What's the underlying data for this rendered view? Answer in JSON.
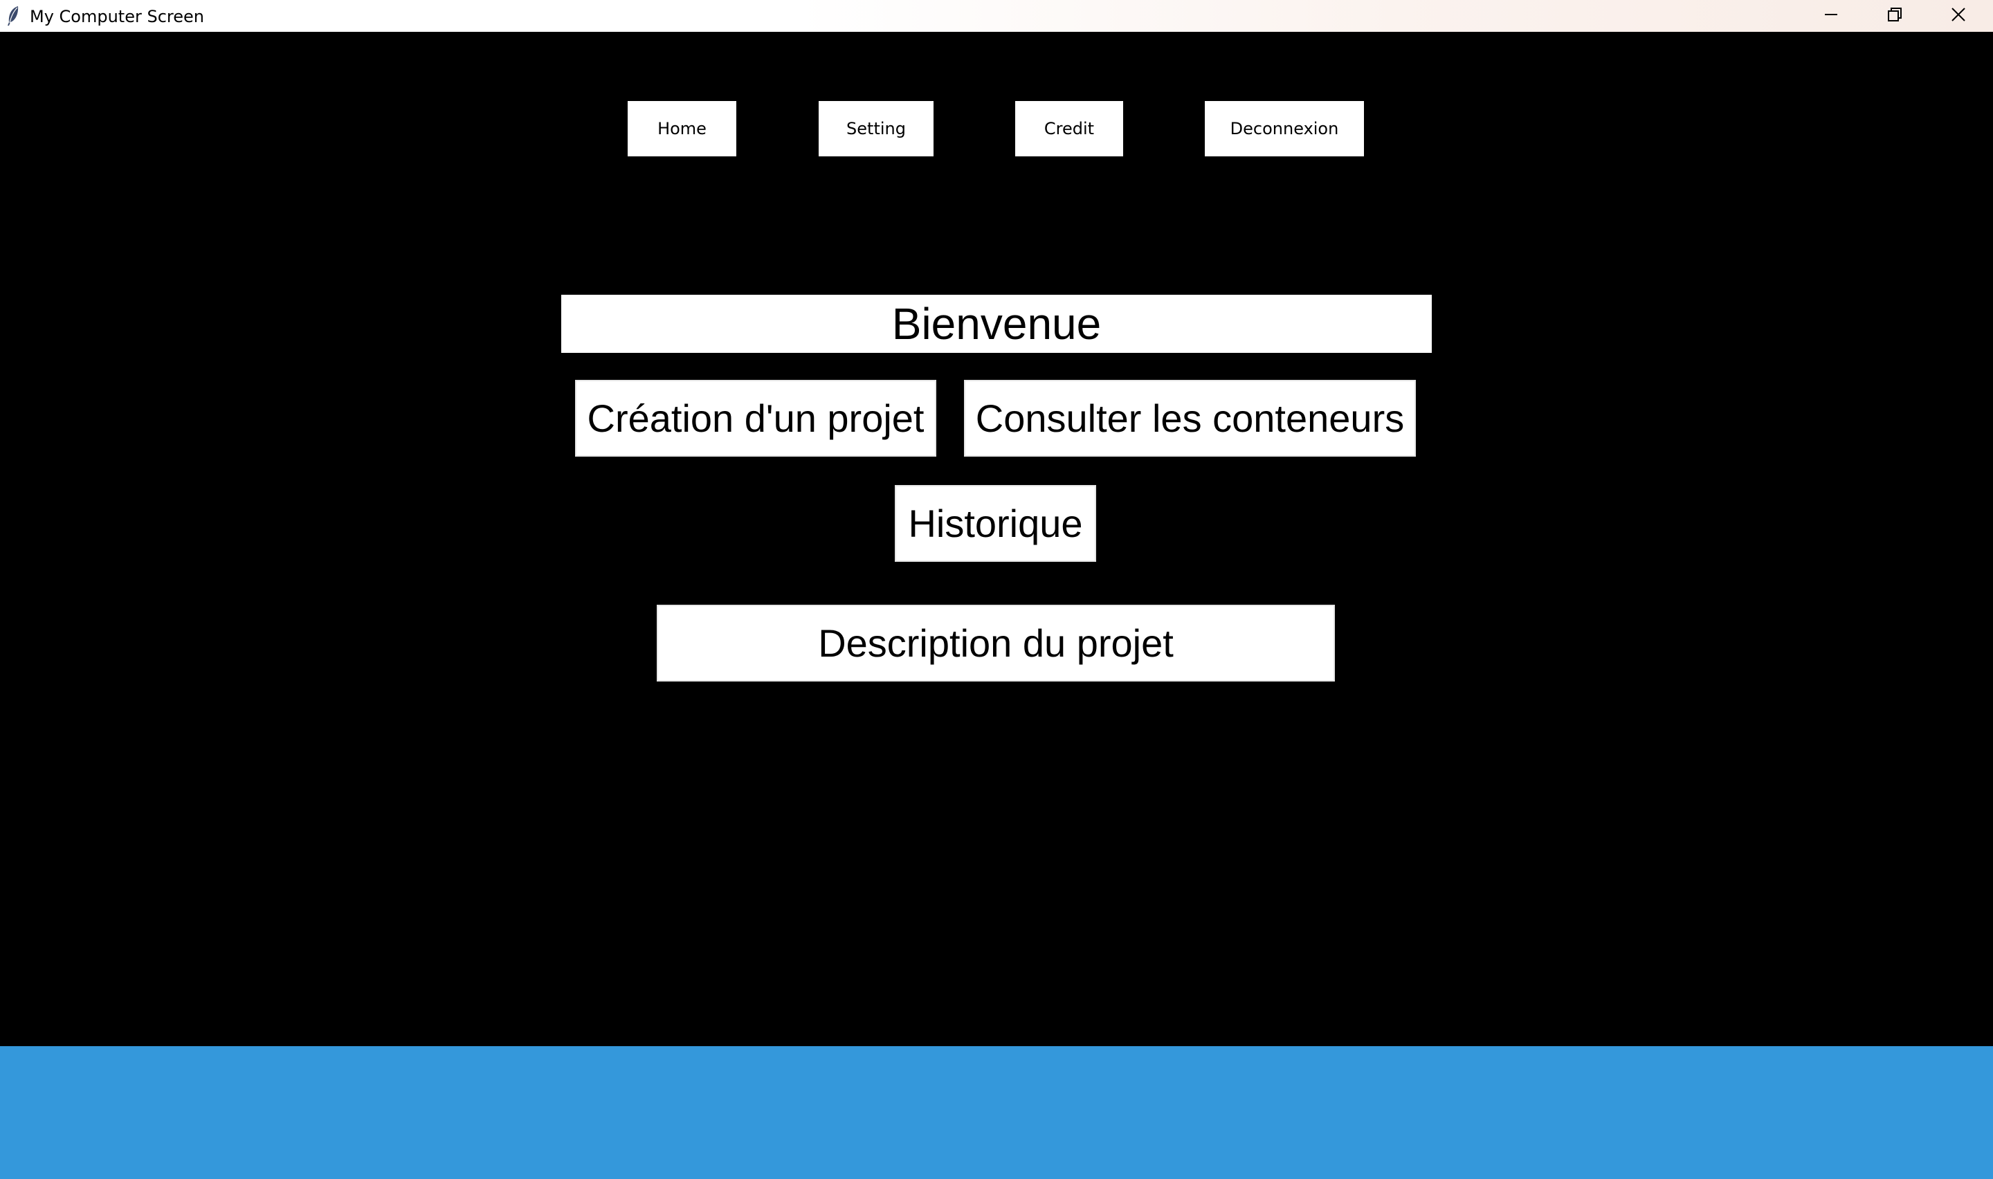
{
  "window": {
    "title": "My Computer Screen",
    "app_icon": "feather-icon",
    "controls": {
      "minimize_icon": "minimize-icon",
      "maximize_icon": "restore-icon",
      "close_icon": "close-icon"
    }
  },
  "nav": {
    "home": "Home",
    "setting": "Setting",
    "credit": "Credit",
    "deconnexion": "Deconnexion"
  },
  "main": {
    "welcome": "Bienvenue",
    "creation": "Création d'un projet",
    "consulter": "Consulter les conteneurs",
    "historique": "Historique",
    "description": "Description du projet"
  },
  "colors": {
    "background": "#000000",
    "button_bg": "#ffffff",
    "bottom_bar": "#3498db"
  }
}
